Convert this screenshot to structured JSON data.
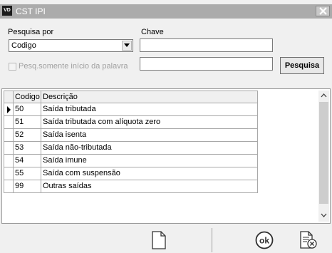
{
  "window": {
    "icon_text": "VD",
    "title": "CST IPI"
  },
  "search": {
    "pesquisa_por_label": "Pesquisa por",
    "pesquisa_por_value": "Codigo",
    "chave_label": "Chave",
    "chave_value": "",
    "second_value": "",
    "checkbox_label": "Pesq.somente início da palavra",
    "search_button": "Pesquisa"
  },
  "grid": {
    "columns": [
      "Codigo",
      "Descrição"
    ],
    "rows": [
      {
        "codigo": "50",
        "descricao": "Saída tributada"
      },
      {
        "codigo": "51",
        "descricao": "Saída tributada com alíquota zero"
      },
      {
        "codigo": "52",
        "descricao": "Saída isenta"
      },
      {
        "codigo": "53",
        "descricao": "Saída não-tributada"
      },
      {
        "codigo": "54",
        "descricao": "Saída imune"
      },
      {
        "codigo": "55",
        "descricao": "Saída com suspensão"
      },
      {
        "codigo": "99",
        "descricao": "Outras saídas"
      }
    ]
  },
  "footer": {
    "ok_label": "ok",
    "icons": [
      "new-document-icon",
      "ok-icon",
      "cancel-document-icon"
    ]
  }
}
